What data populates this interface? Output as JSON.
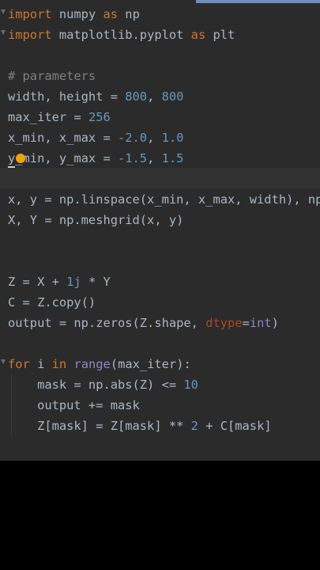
{
  "editor": {
    "accent_color": "#6f8fb8",
    "background_color": "#2b2b2b",
    "lines": {
      "l1": {
        "import": "import",
        "module": " numpy ",
        "as": "as",
        "alias": " np"
      },
      "l2": {
        "import": "import",
        "module": " matplotlib.pyplot ",
        "as": "as",
        "alias": " plt"
      },
      "l4": {
        "comment": "# parameters"
      },
      "l5": {
        "lhs": "width, height = ",
        "n1": "800",
        "sep": ", ",
        "n2": "800"
      },
      "l6": {
        "lhs": "max_iter = ",
        "n1": "256"
      },
      "l7": {
        "lhs": "x_min, x_max = ",
        "n1": "-2.0",
        "sep": ", ",
        "n2": "1.0"
      },
      "l8": {
        "lhs": "y_min, y_max = ",
        "n1": "-1.5",
        "sep": ", ",
        "n2": "1.5"
      },
      "l10": {
        "text": "x, y = np.linspace(x_min, x_max, width), np.linspace(y_min, y_max, height)"
      },
      "l11": {
        "text": "X, Y = np.meshgrid(x, y)"
      },
      "l14": {
        "lhs": "Z = X + ",
        "n1": "1j",
        "rest": " * Y"
      },
      "l15": {
        "text": "C = Z.copy()"
      },
      "l16": {
        "pre": "output = np.zeros(Z.shape, ",
        "param": "dtype",
        "eq": "=",
        "builtin": "int",
        "post": ")"
      },
      "l18": {
        "for": "for",
        "var": " i ",
        "in": "in",
        "sp": " ",
        "builtin": "range",
        "post": "(max_iter):"
      },
      "l19": {
        "lhs": "    mask = np.abs(Z) <= ",
        "n1": "10"
      },
      "l20": {
        "text": "    output += mask"
      },
      "l21": {
        "lhs": "    Z[mask] = Z[mask] ** ",
        "n1": "2",
        "rest": " + C[mask]"
      }
    }
  }
}
